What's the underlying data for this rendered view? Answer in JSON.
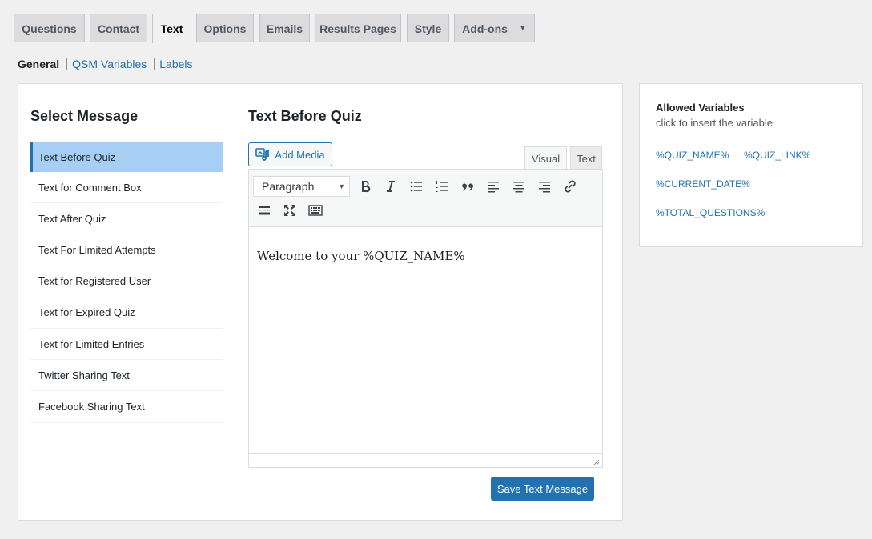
{
  "tabs": [
    {
      "label": "Questions"
    },
    {
      "label": "Contact"
    },
    {
      "label": "Text"
    },
    {
      "label": "Options"
    },
    {
      "label": "Emails"
    },
    {
      "label": "Results Pages"
    },
    {
      "label": "Style"
    },
    {
      "label": "Add-ons"
    }
  ],
  "active_tab": "Text",
  "subnav": {
    "current": "General",
    "links": [
      "QSM Variables",
      "Labels"
    ]
  },
  "left": {
    "title": "Select Message",
    "items": [
      "Text Before Quiz",
      "Text for Comment Box",
      "Text After Quiz",
      "Text For Limited Attempts",
      "Text for Registered User",
      "Text for Expired Quiz",
      "Text for Limited Entries",
      "Twitter Sharing Text",
      "Facebook Sharing Text"
    ],
    "selected": "Text Before Quiz"
  },
  "editor": {
    "title": "Text Before Quiz",
    "add_media": "Add Media",
    "visual_tab": "Visual",
    "text_tab": "Text",
    "format": "Paragraph",
    "content": "Welcome to your %QUIZ_NAME%",
    "save_label": "Save Text Message"
  },
  "side": {
    "title": "Allowed Variables",
    "subtitle": "click to insert the variable",
    "variables": [
      "%QUIZ_NAME%",
      "%QUIZ_LINK%",
      "%CURRENT_DATE%",
      "%TOTAL_QUESTIONS%"
    ]
  },
  "colors": {
    "accent": "#2271b1",
    "selected_bg": "#a7cef4",
    "page_bg": "#f0f0f1"
  }
}
